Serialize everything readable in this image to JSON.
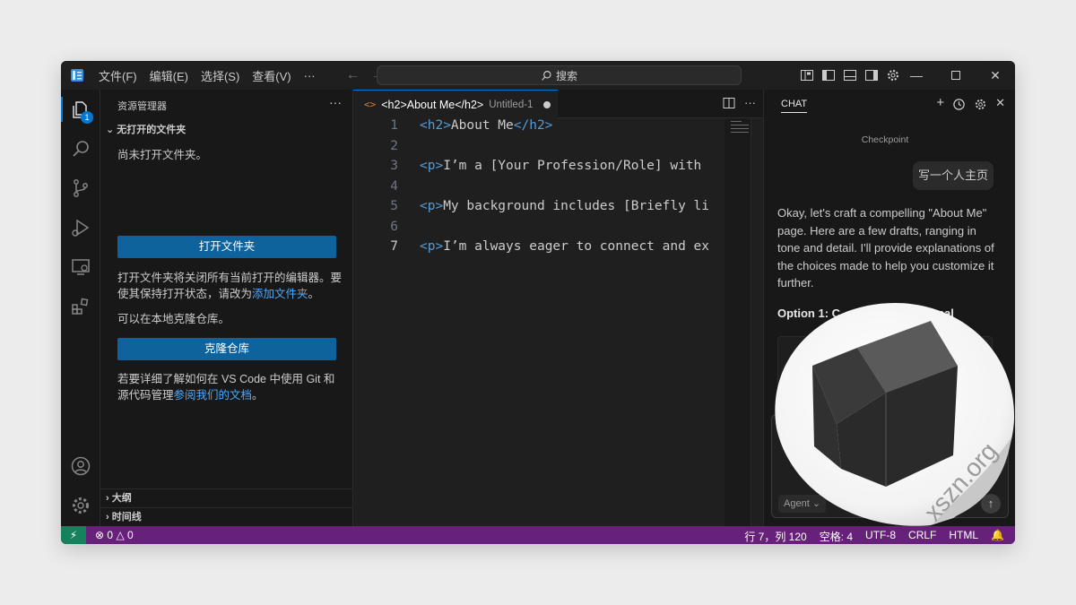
{
  "titlebar": {
    "menu": [
      "文件(F)",
      "编辑(E)",
      "选择(S)",
      "查看(V)",
      "···"
    ],
    "search_text": "搜索"
  },
  "activitybar": {
    "explorer_badge": "1"
  },
  "sidebar": {
    "title": "资源管理器",
    "more": "···",
    "section": "无打开的文件夹",
    "no_folder_text": "尚未打开文件夹。",
    "open_folder_button": "打开文件夹",
    "open_folder_note": "打开文件夹将关闭所有当前打开的编辑器。要使其保持打开状态，请改为",
    "add_folder_link": "添加文件夹",
    "add_folder_end": "。",
    "clone_text": "可以在本地克隆仓库。",
    "clone_button": "克隆仓库",
    "git_text": "若要详细了解如何在 VS Code 中使用 Git 和源代码管理",
    "docs_link": "参阅我们的文档",
    "docs_end": "。",
    "outline": "大纲",
    "timeline": "时间线"
  },
  "editor": {
    "tab_title": "<h2>About Me</h2>",
    "tab_desc": "Untitled-1",
    "lines": [
      {
        "num": "1",
        "open": "<h2>",
        "text": "About Me",
        "close": "</h2>"
      },
      {
        "num": "2"
      },
      {
        "num": "3",
        "open": "<p>",
        "text": "I’m a [Your Profession/Role] with"
      },
      {
        "num": "4"
      },
      {
        "num": "5",
        "open": "<p>",
        "text": "My background includes [Briefly li"
      },
      {
        "num": "6"
      },
      {
        "num": "7",
        "open": "<p>",
        "text": "I’m always eager to connect and ex"
      }
    ]
  },
  "chat": {
    "title": "CHAT",
    "checkpoint": "Checkpoint",
    "user_message": "写一个人主页",
    "response": "Okay, let's craft a compelling \"About Me\" page. Here are a few drafts, ranging in tone and detail. I'll provide explanations of the choices made to help you customize it further.",
    "option_heading": "Option 1: C",
    "option_heading_tail": "nal",
    "input_placeholder": "nter",
    "mode": "Agent"
  },
  "statusbar": {
    "errors": "0",
    "warnings": "0",
    "position": "行 7，列 120",
    "spaces": "空格: 4",
    "encoding": "UTF-8",
    "eol": "CRLF",
    "language": "HTML"
  },
  "watermark": "xszn.org",
  "colors": {
    "accent": "#0078d4",
    "statusbar": "#68217a",
    "remote": "#16825d",
    "button": "#0e639c"
  }
}
